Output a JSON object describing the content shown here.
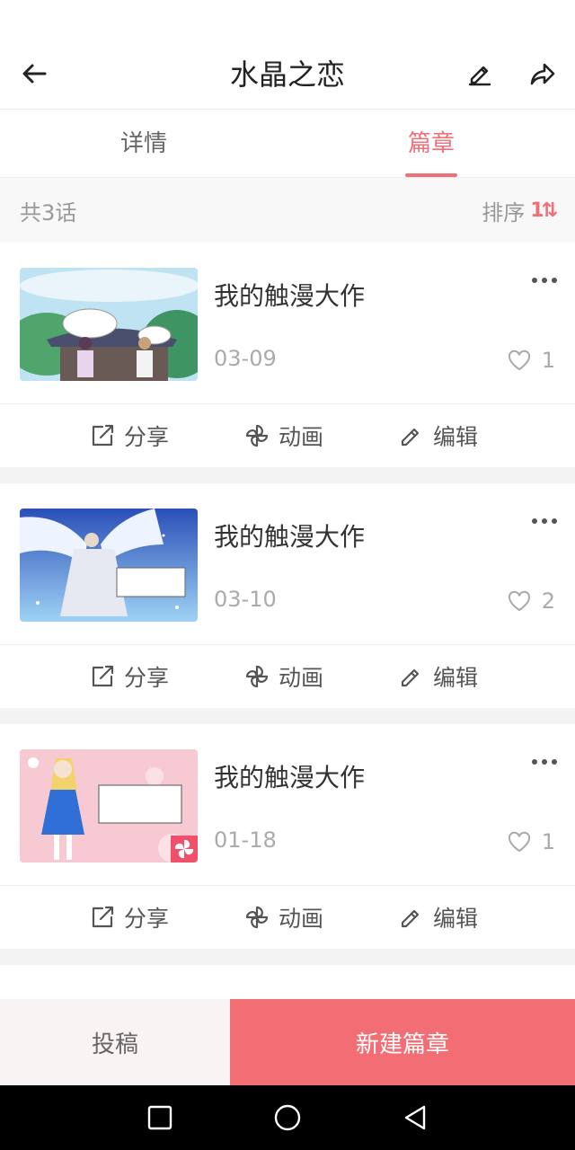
{
  "header": {
    "title": "水晶之恋",
    "back_icon": "arrow-left-icon",
    "edit_icon": "pencil-icon",
    "share_icon": "share-arrow-icon"
  },
  "tabs": [
    {
      "label": "详情",
      "active": false
    },
    {
      "label": "篇章",
      "active": true
    }
  ],
  "summary": {
    "count_label": "共3话",
    "sort_label": "排序",
    "sort_icon_text": "1⇅"
  },
  "chapters": [
    {
      "title": "我的触漫大作",
      "date": "03-09",
      "likes": "1"
    },
    {
      "title": "我的触漫大作",
      "date": "03-10",
      "likes": "2"
    },
    {
      "title": "我的触漫大作",
      "date": "01-18",
      "likes": "1"
    }
  ],
  "actions": {
    "share": "分享",
    "animate": "动画",
    "edit": "编辑"
  },
  "bottom": {
    "submit_label": "投稿",
    "new_label": "新建篇章"
  },
  "colors": {
    "accent": "#f0707a",
    "button": "#f26d74"
  }
}
